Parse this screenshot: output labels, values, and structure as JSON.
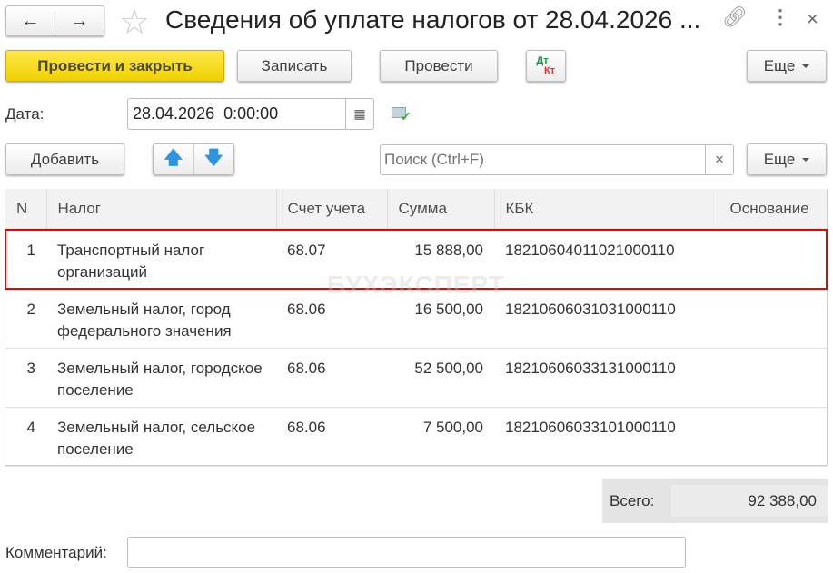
{
  "header": {
    "title": "Сведения об уплате налогов от 28.04.2026 ..."
  },
  "toolbar": {
    "post_close": "Провести и закрыть",
    "save": "Записать",
    "post": "Провести",
    "dt": "Дт",
    "kt": "Кт",
    "more": "Еще"
  },
  "date": {
    "label": "Дата:",
    "value": "28.04.2026  0:00:00"
  },
  "table_toolbar": {
    "add": "Добавить",
    "search_placeholder": "Поиск (Ctrl+F)",
    "clear": "×",
    "more": "Еще"
  },
  "table": {
    "columns": [
      "N",
      "Налог",
      "Счет учета",
      "Сумма",
      "КБК",
      "Основание"
    ],
    "rows": [
      {
        "n": "1",
        "tax": "Транспортный налог организаций",
        "account": "68.07",
        "sum": "15 888,00",
        "kbk": "18210604011021000110",
        "basis": ""
      },
      {
        "n": "2",
        "tax": "Земельный налог, город федерального значения",
        "account": "68.06",
        "sum": "16 500,00",
        "kbk": "18210606031031000110",
        "basis": ""
      },
      {
        "n": "3",
        "tax": "Земельный налог, городское поселение",
        "account": "68.06",
        "sum": "52 500,00",
        "kbk": "18210606033131000110",
        "basis": ""
      },
      {
        "n": "4",
        "tax": "Земельный налог, сельское поселение",
        "account": "68.06",
        "sum": "7 500,00",
        "kbk": "18210606033101000110",
        "basis": ""
      }
    ]
  },
  "total": {
    "label": "Всего:",
    "value": "92 388,00"
  },
  "comment": {
    "label": "Комментарий:",
    "value": ""
  },
  "watermark": "БУХЭКСПЕРТ"
}
